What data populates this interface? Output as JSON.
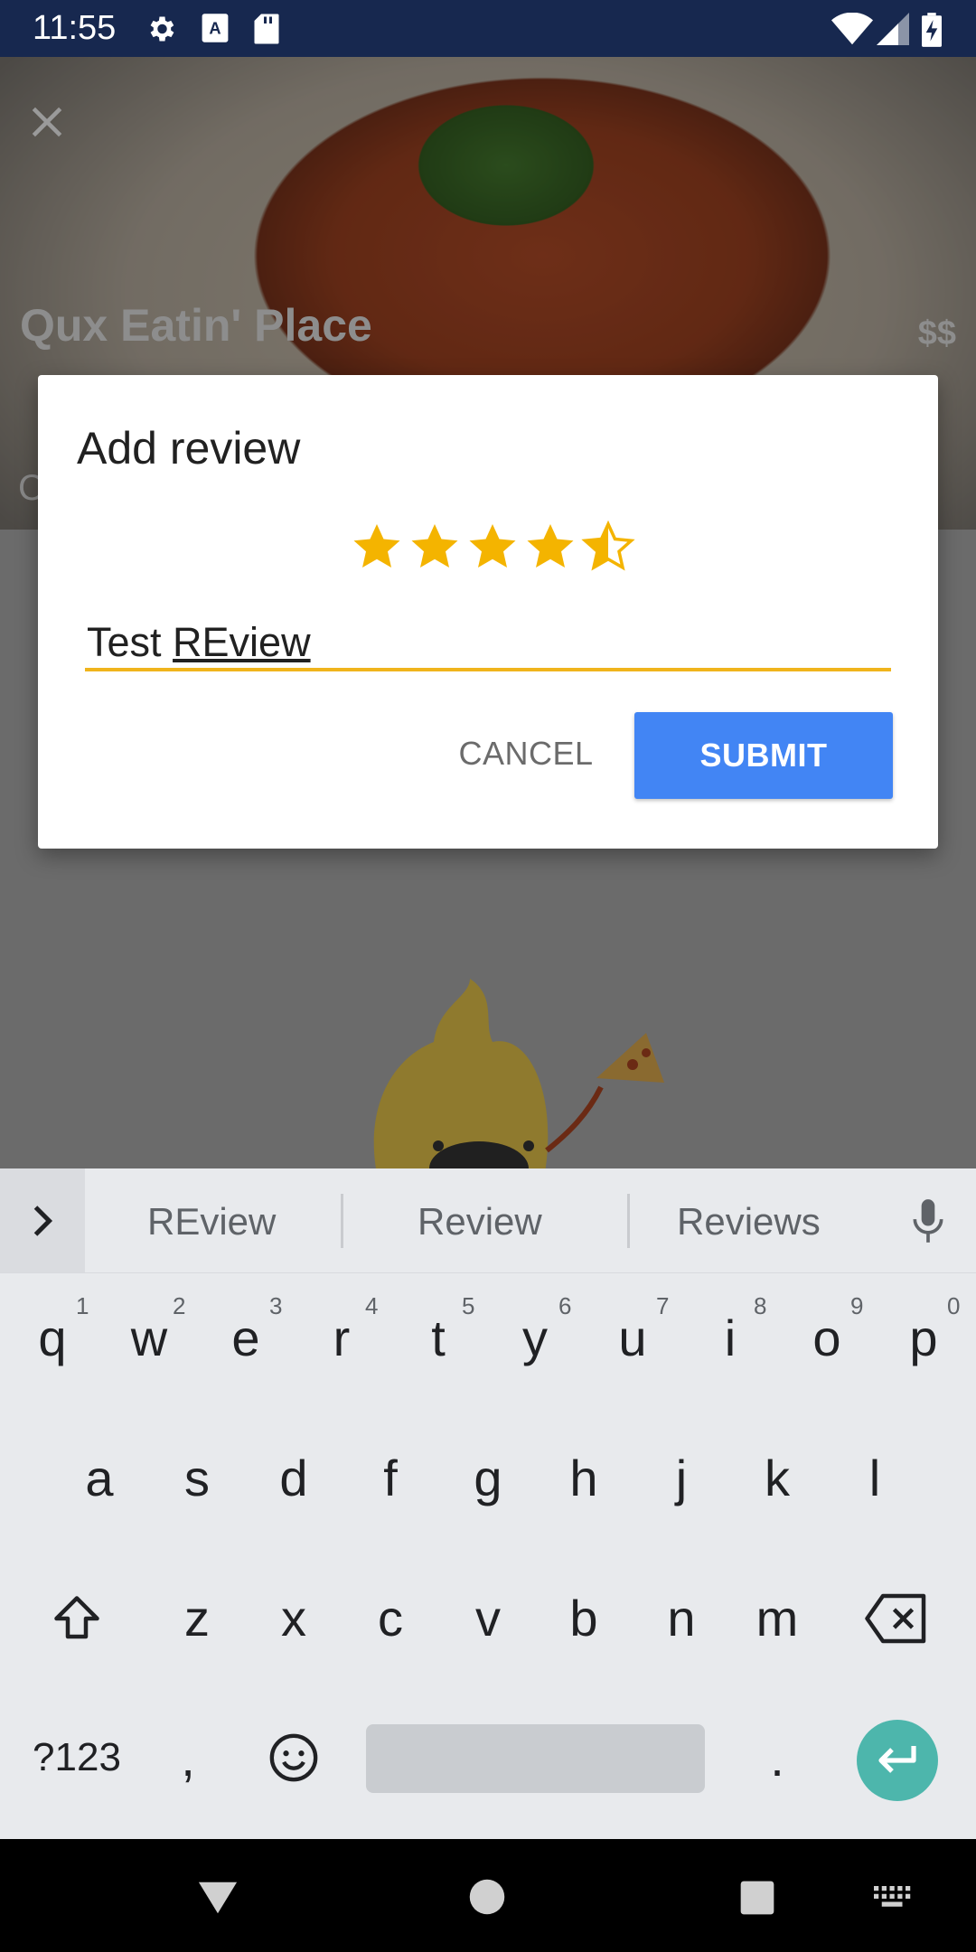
{
  "status_bar": {
    "time": "11:55"
  },
  "background": {
    "restaurant_name": "Qux Eatin' Place",
    "price": "$$",
    "category_initial": "C"
  },
  "dialog": {
    "title": "Add review",
    "rating": 4.5,
    "review_prefix": "Test ",
    "review_underlined": "REview",
    "cancel_label": "CANCEL",
    "submit_label": "SUBMIT",
    "accent_color": "#f0b41c",
    "submit_color": "#4285f4"
  },
  "keyboard": {
    "suggestions": [
      "REview",
      "Review",
      "Reviews"
    ],
    "row1": [
      "q",
      "w",
      "e",
      "r",
      "t",
      "y",
      "u",
      "i",
      "o",
      "p"
    ],
    "row1_nums": [
      "1",
      "2",
      "3",
      "4",
      "5",
      "6",
      "7",
      "8",
      "9",
      "0"
    ],
    "row2": [
      "a",
      "s",
      "d",
      "f",
      "g",
      "h",
      "j",
      "k",
      "l"
    ],
    "row3": [
      "z",
      "x",
      "c",
      "v",
      "b",
      "n",
      "m"
    ],
    "symbols_label": "?123",
    "comma": ",",
    "period": "."
  },
  "icons": {
    "status": [
      "settings-icon",
      "a-icon",
      "sd-card-icon",
      "wifi-icon",
      "signal-icon",
      "battery-icon"
    ],
    "nav": [
      "back-icon",
      "home-icon",
      "recents-icon",
      "keyboard-icon"
    ]
  }
}
